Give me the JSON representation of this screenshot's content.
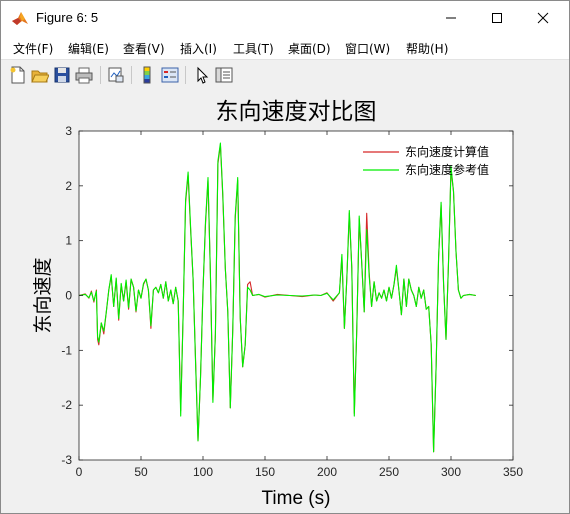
{
  "window": {
    "title": "Figure 6: 5",
    "buttons": [
      "minimize",
      "maximize",
      "close"
    ]
  },
  "menu": [
    "文件(F)",
    "编辑(E)",
    "查看(V)",
    "插入(I)",
    "工具(T)",
    "桌面(D)",
    "窗口(W)",
    "帮助(H)"
  ],
  "toolbar": {
    "icons": [
      "new-figure-icon",
      "open-file-icon",
      "save-icon",
      "print-icon",
      "link-plot-icon",
      "colorbar-icon",
      "legend-icon",
      "pointer-icon",
      "property-inspector-icon"
    ]
  },
  "colors": {
    "background": "#f0f0f0",
    "series_computed": "#d62728",
    "series_reference": "#00ee00"
  },
  "chart_data": {
    "type": "line",
    "title": "东向速度对比图",
    "xlabel": "Time (s)",
    "ylabel": "东向速度",
    "xlim": [
      0,
      350
    ],
    "ylim": [
      -3,
      3
    ],
    "xticks": [
      0,
      50,
      100,
      150,
      200,
      250,
      300,
      350
    ],
    "yticks": [
      -3,
      -2,
      -1,
      0,
      1,
      2,
      3
    ],
    "grid": false,
    "legend_position": "top-right",
    "series": [
      {
        "name": "东向速度计算值",
        "color": "#d62728",
        "x": [
          0,
          5,
          8,
          10,
          12,
          14,
          15,
          16,
          18,
          20,
          22,
          24,
          26,
          28,
          30,
          32,
          34,
          36,
          38,
          40,
          42,
          44,
          46,
          48,
          50,
          52,
          54,
          56,
          58,
          60,
          62,
          64,
          66,
          68,
          70,
          72,
          74,
          76,
          78,
          80,
          82,
          84,
          86,
          88,
          90,
          92,
          94,
          96,
          98,
          100,
          102,
          104,
          106,
          108,
          110,
          112,
          114,
          116,
          118,
          120,
          122,
          124,
          126,
          128,
          130,
          132,
          134,
          136,
          138,
          140,
          145,
          150,
          160,
          170,
          180,
          190,
          195,
          200,
          205,
          210,
          212,
          214,
          216,
          218,
          220,
          222,
          224,
          226,
          228,
          230,
          232,
          234,
          236,
          238,
          240,
          242,
          244,
          246,
          248,
          250,
          252,
          254,
          256,
          258,
          260,
          262,
          264,
          266,
          268,
          270,
          272,
          274,
          276,
          278,
          280,
          282,
          284,
          286,
          288,
          290,
          292,
          294,
          296,
          298,
          300,
          302,
          304,
          306,
          308,
          310,
          315,
          320
        ],
        "y": [
          0,
          0.03,
          -0.05,
          0.08,
          -0.12,
          0.1,
          -0.8,
          -0.9,
          -0.5,
          -0.7,
          -0.3,
          0.1,
          0.35,
          -0.2,
          0.3,
          -0.45,
          0.2,
          -0.1,
          0.25,
          -0.25,
          0.3,
          0.15,
          -0.3,
          0.1,
          -0.05,
          0.2,
          0.3,
          0.1,
          -0.6,
          0.1,
          0.15,
          0.05,
          0.2,
          -0.05,
          0.25,
          -0.1,
          0.1,
          -0.15,
          0.15,
          -0.1,
          -2.1,
          -0.3,
          1.7,
          2.2,
          1.2,
          0.3,
          -1.2,
          -2.65,
          -1.5,
          0.1,
          1.3,
          2.1,
          0.4,
          -1.9,
          -0.7,
          2.4,
          2.75,
          1.8,
          0.5,
          -0.3,
          -2.05,
          -0.6,
          1.4,
          2.1,
          -0.4,
          -1.3,
          -0.9,
          0.2,
          0.25,
          0.0,
          0.02,
          -0.03,
          0.02,
          0.0,
          -0.02,
          0.01,
          0.0,
          0.05,
          -0.1,
          0.05,
          0.7,
          -0.6,
          0.3,
          1.5,
          0.5,
          -2.15,
          -0.6,
          1.4,
          0.6,
          -0.3,
          1.5,
          0.4,
          -0.2,
          0.25,
          -0.1,
          0.05,
          -0.05,
          0.1,
          -0.1,
          0.15,
          -0.05,
          0.2,
          0.5,
          0.1,
          -0.35,
          0.3,
          -0.2,
          0.3,
          0.1,
          0.0,
          -0.2,
          0.15,
          -0.05,
          0.1,
          -0.25,
          -0.2,
          -0.9,
          -2.85,
          -1.3,
          0.7,
          1.65,
          0.2,
          -0.8,
          0.6,
          2.3,
          1.9,
          0.8,
          0.1,
          -0.05,
          0.0,
          0.02,
          0.0
        ]
      },
      {
        "name": "东向速度参考值",
        "color": "#00ee00",
        "x": [
          0,
          5,
          8,
          10,
          12,
          14,
          15,
          16,
          18,
          20,
          22,
          24,
          26,
          28,
          30,
          32,
          34,
          36,
          38,
          40,
          42,
          44,
          46,
          48,
          50,
          52,
          54,
          56,
          58,
          60,
          62,
          64,
          66,
          68,
          70,
          72,
          74,
          76,
          78,
          80,
          82,
          84,
          86,
          88,
          90,
          92,
          94,
          96,
          98,
          100,
          102,
          104,
          106,
          108,
          110,
          112,
          114,
          116,
          118,
          120,
          122,
          124,
          126,
          128,
          130,
          132,
          134,
          136,
          138,
          140,
          145,
          150,
          160,
          170,
          180,
          190,
          195,
          200,
          205,
          210,
          212,
          214,
          216,
          218,
          220,
          222,
          224,
          226,
          228,
          230,
          232,
          234,
          236,
          238,
          240,
          242,
          244,
          246,
          248,
          250,
          252,
          254,
          256,
          258,
          260,
          262,
          264,
          266,
          268,
          270,
          272,
          274,
          276,
          278,
          280,
          282,
          284,
          286,
          288,
          290,
          292,
          294,
          296,
          298,
          300,
          302,
          304,
          306,
          308,
          310,
          315,
          320
        ],
        "y": [
          0,
          0.02,
          -0.04,
          0.06,
          -0.1,
          0.08,
          -0.75,
          -0.85,
          -0.5,
          -0.65,
          -0.3,
          0.1,
          0.38,
          -0.2,
          0.32,
          -0.42,
          0.22,
          -0.1,
          0.28,
          -0.22,
          0.3,
          0.15,
          -0.28,
          0.1,
          -0.05,
          0.22,
          0.3,
          0.1,
          -0.55,
          0.1,
          0.15,
          0.05,
          0.2,
          -0.05,
          0.25,
          -0.1,
          0.1,
          -0.15,
          0.15,
          -0.1,
          -2.2,
          -0.3,
          1.75,
          2.25,
          1.25,
          0.3,
          -1.25,
          -2.65,
          -1.5,
          0.1,
          1.35,
          2.15,
          0.4,
          -1.95,
          -0.7,
          2.45,
          2.78,
          1.85,
          0.5,
          -0.3,
          -2.05,
          -0.6,
          1.45,
          2.15,
          -0.4,
          -1.3,
          -0.9,
          0.15,
          0.1,
          0.0,
          0.02,
          -0.02,
          0.01,
          0.0,
          -0.01,
          0.01,
          0.0,
          0.04,
          -0.08,
          0.05,
          0.75,
          -0.6,
          0.3,
          1.55,
          0.5,
          -2.2,
          -0.6,
          1.45,
          0.6,
          -0.3,
          1.2,
          0.35,
          -0.2,
          0.25,
          -0.1,
          0.05,
          -0.05,
          0.1,
          -0.1,
          0.15,
          -0.05,
          0.2,
          0.55,
          0.1,
          -0.35,
          0.3,
          -0.2,
          0.3,
          0.1,
          0.0,
          -0.2,
          0.15,
          -0.05,
          0.1,
          -0.25,
          -0.2,
          -0.9,
          -2.85,
          -1.3,
          0.7,
          1.7,
          0.2,
          -0.8,
          0.6,
          2.35,
          1.9,
          0.8,
          0.1,
          -0.05,
          0.0,
          0.02,
          0.0
        ]
      }
    ]
  }
}
